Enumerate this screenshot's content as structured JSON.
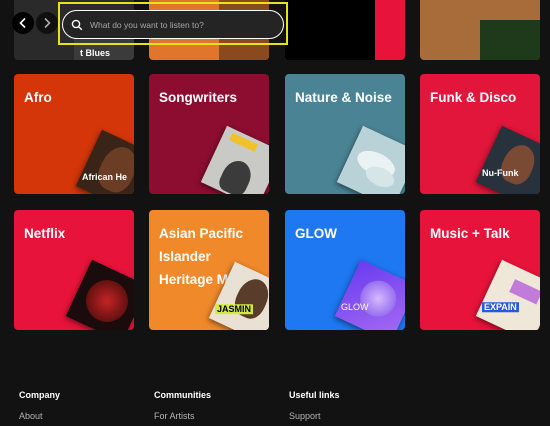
{
  "search": {
    "placeholder": "What do you want to listen to?"
  },
  "top_partial": {
    "fragment_text": "t Blues"
  },
  "genres": [
    {
      "label": "Afro",
      "color": "#d4360a",
      "art_text": "African He"
    },
    {
      "label": "Songwriters",
      "color": "#8c0d30",
      "art_text": ""
    },
    {
      "label": "Nature & Noise",
      "color": "#4a8494",
      "art_text": ""
    },
    {
      "label": "Funk & Disco",
      "color": "#e1163a",
      "art_text": "Nu-Funk"
    },
    {
      "label": "Netflix",
      "color": "#e8133a",
      "art_text": ""
    },
    {
      "label": "Asian Pacific Islander Heritage Month",
      "color": "#f0892a",
      "art_text": "JASMIN"
    },
    {
      "label": "GLOW",
      "color": "#1d78f2",
      "art_text": "GLOW"
    },
    {
      "label": "Music + Talk",
      "color": "#e8133a",
      "art_text": "EXPAIN"
    }
  ],
  "footer": {
    "company": {
      "heading": "Company",
      "link": "About"
    },
    "communities": {
      "heading": "Communities",
      "link": "For Artists"
    },
    "useful_links": {
      "heading": "Useful links",
      "link": "Support"
    }
  }
}
